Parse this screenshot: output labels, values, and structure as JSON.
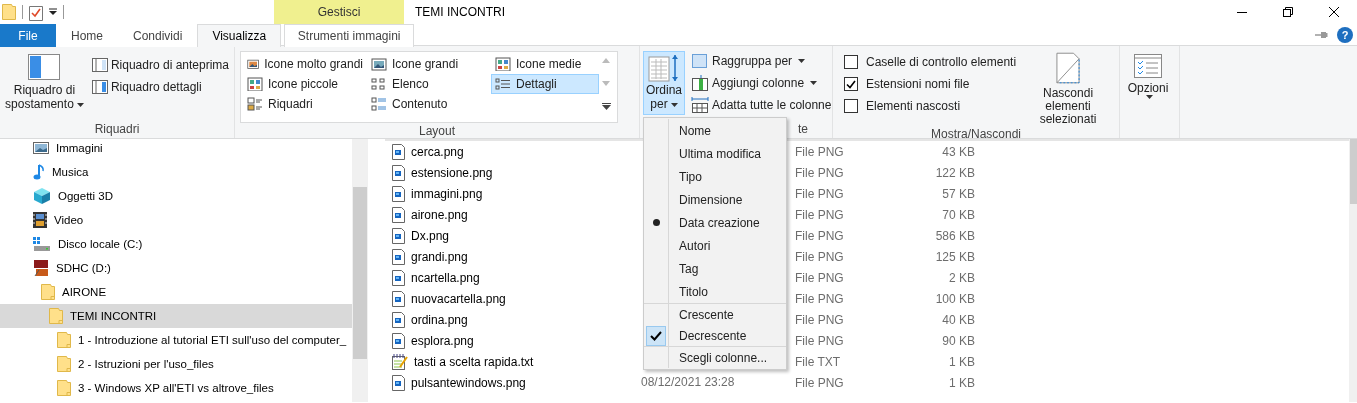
{
  "window": {
    "title": "TEMI INCONTRI"
  },
  "contextual_tab": {
    "label": "Gestisci"
  },
  "tabs": [
    {
      "label": "File",
      "kind": "file",
      "selected": false
    },
    {
      "label": "Home",
      "kind": "tab",
      "selected": false
    },
    {
      "label": "Condividi",
      "kind": "tab",
      "selected": false
    },
    {
      "label": "Visualizza",
      "kind": "tab",
      "selected": true
    },
    {
      "label": "Strumenti immagini",
      "kind": "contextual",
      "selected": false
    }
  ],
  "help_button": {
    "label": "?"
  },
  "ribbon": {
    "panes": {
      "label": "Riquadri",
      "navigation_pane": {
        "label": "Riquadro di spostamento",
        "dropdown": true
      },
      "buttons": [
        {
          "label": "Riquadro di anteprima"
        },
        {
          "label": "Riquadro dettagli"
        }
      ]
    },
    "layout": {
      "label": "Layout",
      "options": [
        {
          "label": "Icone molto grandi",
          "selected": false
        },
        {
          "label": "Icone grandi",
          "selected": false
        },
        {
          "label": "Icone medie",
          "selected": false
        },
        {
          "label": "Icone piccole",
          "selected": false
        },
        {
          "label": "Elenco",
          "selected": false
        },
        {
          "label": "Dettagli",
          "selected": true
        },
        {
          "label": "Riquadri",
          "selected": false
        },
        {
          "label": "Contenuto",
          "selected": false
        }
      ]
    },
    "current_view": {
      "label": "te",
      "sort_button": {
        "label": "Ordina per",
        "pressed": true
      },
      "buttons": [
        {
          "label": "Raggruppa per",
          "dropdown": true
        },
        {
          "label": "Aggiungi colonne",
          "dropdown": true
        },
        {
          "label": "Adatta tutte le colonne",
          "dropdown": false
        }
      ]
    },
    "show_hide": {
      "label": "Mostra/Nascondi",
      "checkboxes": [
        {
          "label": "Caselle di controllo elementi",
          "checked": false
        },
        {
          "label": "Estensioni nomi file",
          "checked": true
        },
        {
          "label": "Elementi nascosti",
          "checked": false
        }
      ],
      "hide_button": {
        "label": "Nascondi elementi selezionati"
      }
    },
    "options": {
      "label": "Opzioni",
      "dropdown": true
    }
  },
  "navigation": {
    "items": [
      {
        "label": "Immagini",
        "kind": "pictures",
        "selected": false
      },
      {
        "label": "Musica",
        "kind": "music",
        "selected": false
      },
      {
        "label": "Oggetti 3D",
        "kind": "objects3d",
        "selected": false
      },
      {
        "label": "Video",
        "kind": "video",
        "selected": false
      },
      {
        "label": "Disco locale (C:)",
        "kind": "drive",
        "selected": false
      },
      {
        "label": "SDHC (D:)",
        "kind": "sd",
        "selected": false,
        "children": [
          {
            "label": "AIRONE",
            "kind": "folder",
            "selected": false,
            "children": [
              {
                "label": "TEMI INCONTRI",
                "kind": "folder",
                "selected": true,
                "children": [
                  {
                    "label": "1 - Introduzione al tutorial ETI sull'uso del computer_",
                    "kind": "folder",
                    "selected": false
                  },
                  {
                    "label": "2 - Istruzioni per l'uso_files",
                    "kind": "folder",
                    "selected": false
                  },
                  {
                    "label": "3 - Windows XP all'ETI vs altrove_files",
                    "kind": "folder",
                    "selected": false
                  }
                ]
              }
            ]
          }
        ]
      }
    ]
  },
  "files": {
    "rows": [
      {
        "name": "cerca.png",
        "kind": "image",
        "type": "File PNG",
        "size": "43 KB"
      },
      {
        "name": "estensione.png",
        "kind": "image",
        "type": "File PNG",
        "size": "122 KB"
      },
      {
        "name": "immagini.png",
        "kind": "image",
        "type": "File PNG",
        "size": "57 KB"
      },
      {
        "name": "airone.png",
        "kind": "image",
        "type": "File PNG",
        "size": "70 KB"
      },
      {
        "name": "Dx.png",
        "kind": "image",
        "type": "File PNG",
        "size": "586 KB"
      },
      {
        "name": "grandi.png",
        "kind": "image",
        "type": "File PNG",
        "size": "125 KB"
      },
      {
        "name": "ncartella.png",
        "kind": "image",
        "type": "File PNG",
        "size": "2 KB"
      },
      {
        "name": "nuovacartella.png",
        "kind": "image",
        "type": "File PNG",
        "size": "100 KB"
      },
      {
        "name": "ordina.png",
        "kind": "image",
        "type": "File PNG",
        "size": "40 KB"
      },
      {
        "name": "esplora.png",
        "kind": "image",
        "type": "File PNG",
        "size": "90 KB"
      },
      {
        "name": "tasti a scelta rapida.txt",
        "kind": "text",
        "type": "File TXT",
        "size": "1 KB"
      },
      {
        "name": "pulsantewindows.png",
        "kind": "image",
        "date": "08/12/2021 23:28",
        "type": "File PNG",
        "size": "1 KB"
      }
    ]
  },
  "sort_menu": {
    "sections": [
      {
        "kind": "radio",
        "items": [
          {
            "label": "Nome",
            "selected": false
          },
          {
            "label": "Ultima modifica",
            "selected": false
          },
          {
            "label": "Tipo",
            "selected": false
          },
          {
            "label": "Dimensione",
            "selected": false
          },
          {
            "label": "Data creazione",
            "selected": true
          },
          {
            "label": "Autori",
            "selected": false
          },
          {
            "label": "Tag",
            "selected": false
          },
          {
            "label": "Titolo",
            "selected": false
          }
        ]
      },
      {
        "kind": "check",
        "items": [
          {
            "label": "Crescente",
            "selected": false
          },
          {
            "label": "Decrescente",
            "selected": true
          }
        ]
      },
      {
        "kind": "command",
        "items": [
          {
            "label": "Scegli colonne..."
          }
        ]
      }
    ]
  }
}
